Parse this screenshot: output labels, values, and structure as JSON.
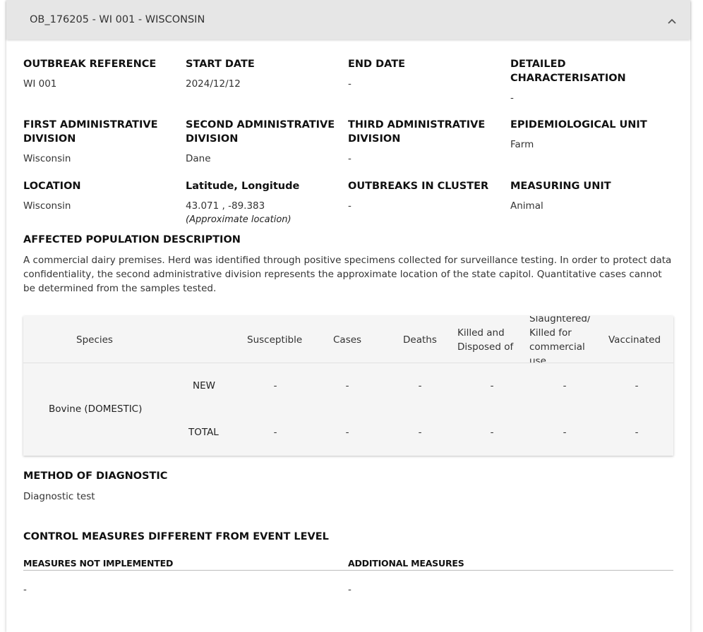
{
  "header": {
    "title": "OB_176205 - WI 001 - WISCONSIN",
    "icon": "chevron-up-icon"
  },
  "fields": {
    "outbreak_reference": {
      "label": "OUTBREAK REFERENCE",
      "value": "WI 001"
    },
    "start_date": {
      "label": "START DATE",
      "value": "2024/12/12"
    },
    "end_date": {
      "label": "END DATE",
      "value": "-"
    },
    "detailed_characterisation": {
      "label": "DETAILED CHARACTERISATION",
      "value": "-"
    },
    "first_admin_division": {
      "label": "FIRST ADMINISTRATIVE DIVISION",
      "value": "Wisconsin"
    },
    "second_admin_division": {
      "label": "SECOND ADMINISTRATIVE DIVISION",
      "value": "Dane"
    },
    "third_admin_division": {
      "label": "THIRD ADMINISTRATIVE DIVISION",
      "value": "-"
    },
    "epidemiological_unit": {
      "label": "EPIDEMIOLOGICAL UNIT",
      "value": "Farm"
    },
    "location": {
      "label": "LOCATION",
      "value": "Wisconsin"
    },
    "lat_long": {
      "label": "Latitude, Longitude",
      "value": "43.071 , -89.383",
      "note": "(Approximate location)"
    },
    "outbreaks_in_cluster": {
      "label": "OUTBREAKS IN CLUSTER",
      "value": "-"
    },
    "measuring_unit": {
      "label": "MEASURING UNIT",
      "value": "Animal"
    }
  },
  "affected_population": {
    "title": "AFFECTED POPULATION DESCRIPTION",
    "text": "A commercial dairy premises. Herd was identified through positive specimens collected for surveillance testing. In order to protect data confidentiality, the second administrative division represents the approximate location of the state capitol. Quantitative cases cannot be determined from the samples tested."
  },
  "table": {
    "columns": [
      "Species",
      "Susceptible",
      "Cases",
      "Deaths",
      "Killed and Disposed of",
      "Slaughtered/ Killed for commercial use",
      "Vaccinated"
    ],
    "species": "Bovine (DOMESTIC)",
    "rows": [
      {
        "type": "NEW",
        "values": [
          "-",
          "-",
          "-",
          "-",
          "-",
          "-"
        ]
      },
      {
        "type": "TOTAL",
        "values": [
          "-",
          "-",
          "-",
          "-",
          "-",
          "-"
        ]
      }
    ]
  },
  "diagnostic": {
    "title": "METHOD OF DIAGNOSTIC",
    "value": "Diagnostic test"
  },
  "control_measures": {
    "title": "CONTROL MEASURES DIFFERENT FROM EVENT LEVEL",
    "not_implemented_label": "MEASURES NOT IMPLEMENTED",
    "not_implemented_value": "-",
    "additional_label": "ADDITIONAL MEASURES",
    "additional_value": "-"
  }
}
